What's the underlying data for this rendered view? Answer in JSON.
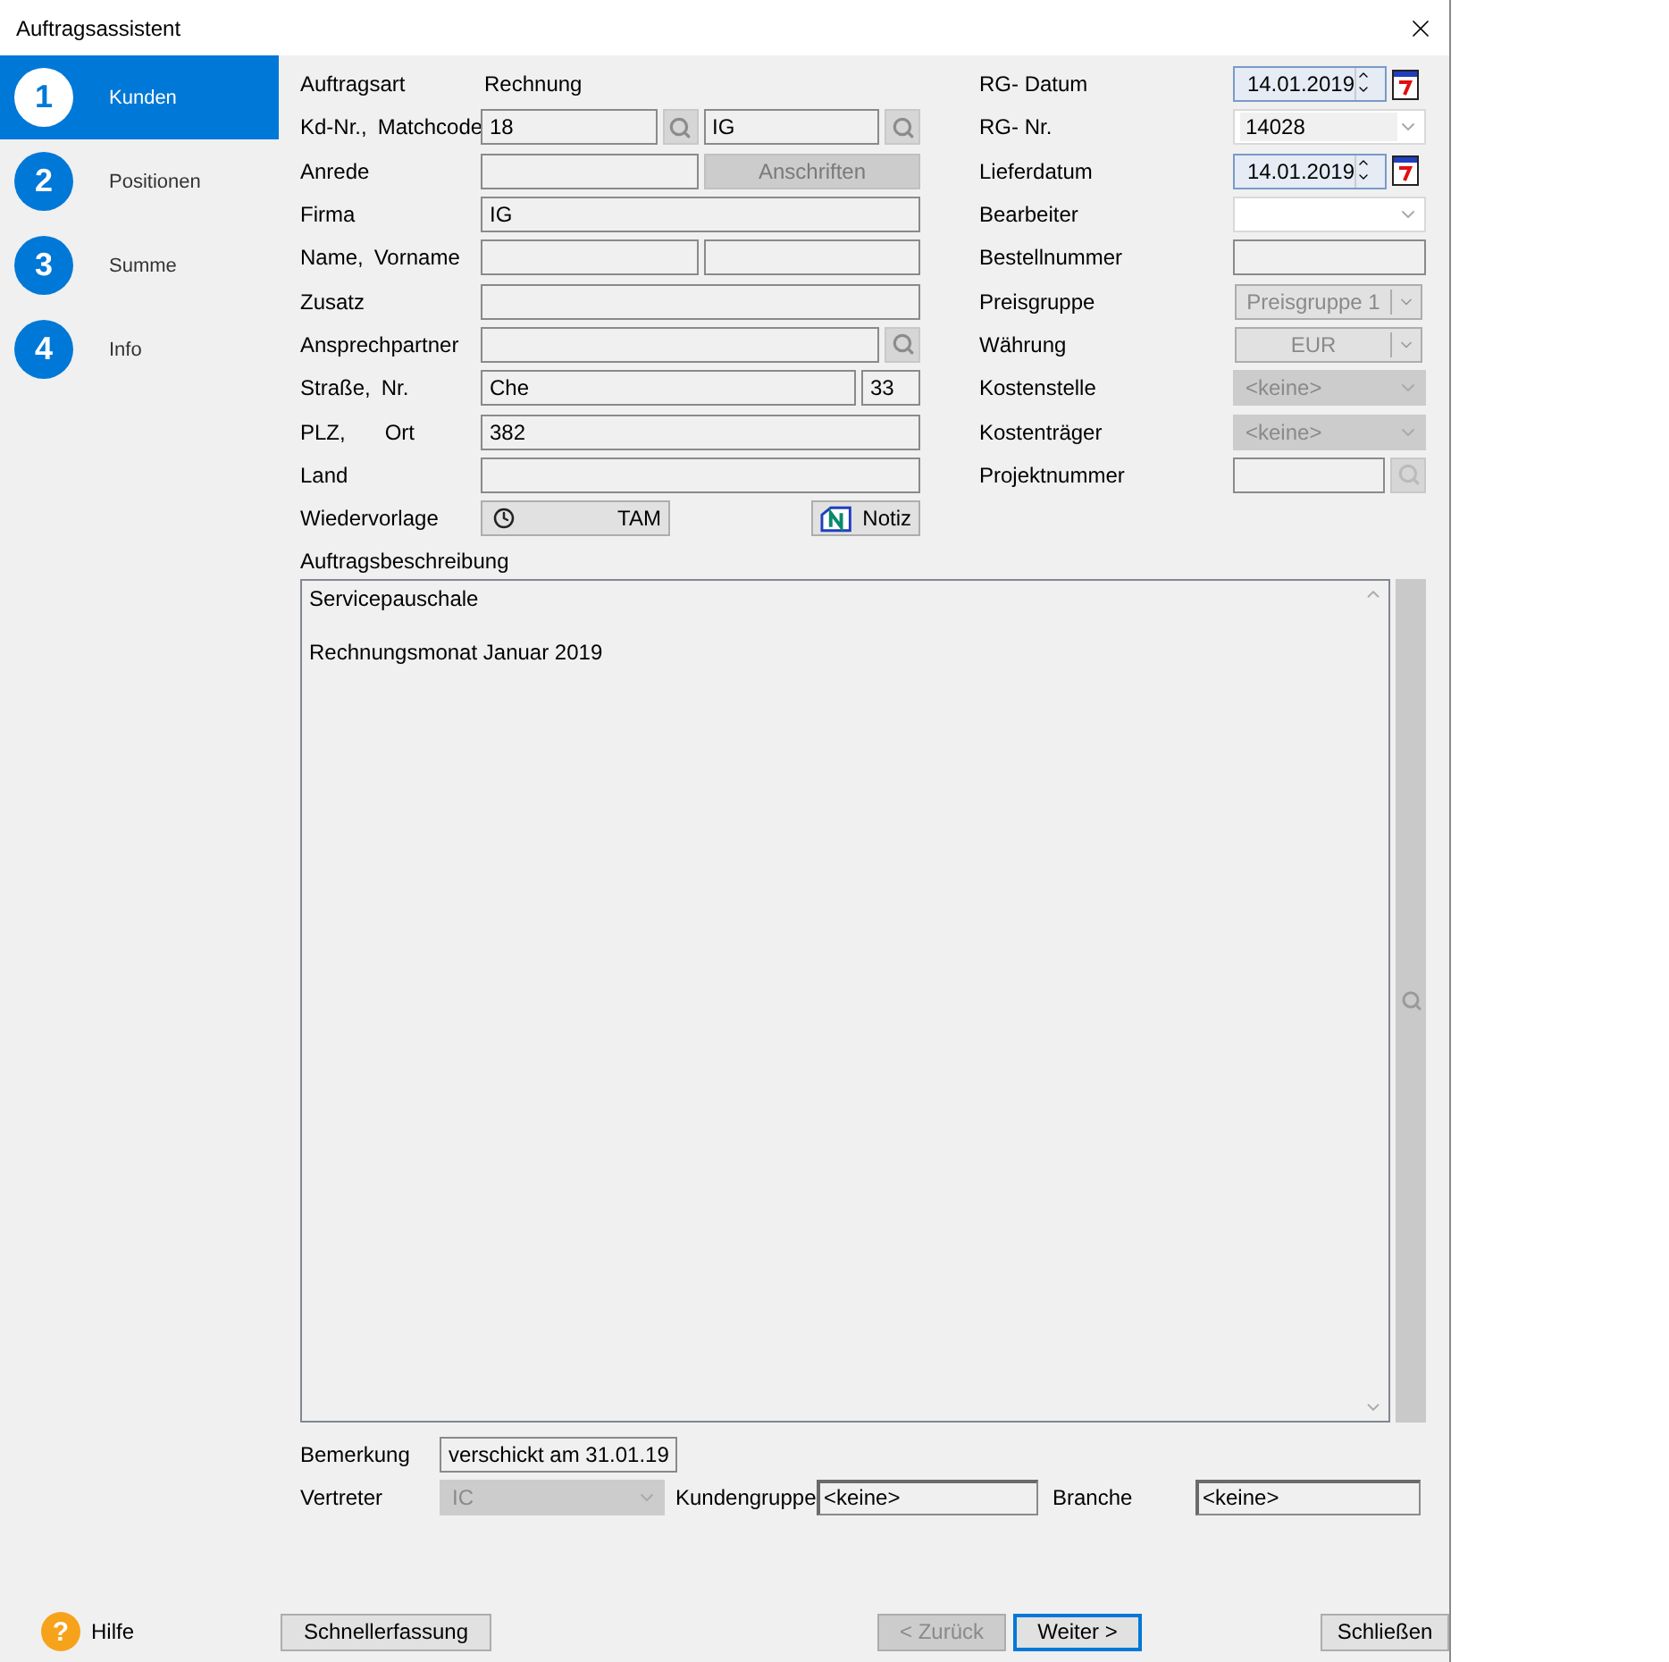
{
  "window": {
    "title": "Auftragsassistent"
  },
  "steps": [
    {
      "number": "1",
      "label": "Kunden",
      "selected": true
    },
    {
      "number": "2",
      "label": "Positionen",
      "selected": false
    },
    {
      "number": "3",
      "label": "Summe",
      "selected": false
    },
    {
      "number": "4",
      "label": "Info",
      "selected": false
    }
  ],
  "help": {
    "badge": "?",
    "label": "Hilfe"
  },
  "left_rows": [
    {
      "kind": "static",
      "labels": [
        "Auftragsart"
      ],
      "value": "Rechnung"
    },
    {
      "kind": "lookup_pair",
      "labels": [
        "Kd-Nr.,",
        "Matchcode"
      ],
      "values": [
        "18",
        "IG"
      ]
    },
    {
      "kind": "input_button",
      "labels": [
        "Anrede"
      ],
      "button": {
        "label": "Anschriften",
        "disabled": true
      }
    },
    {
      "kind": "input",
      "labels": [
        "Firma"
      ],
      "value": "IG"
    },
    {
      "kind": "pair",
      "labels": [
        "Name,",
        "Vorname"
      ]
    },
    {
      "kind": "input",
      "labels": [
        "Zusatz"
      ]
    },
    {
      "kind": "input_lookup",
      "labels": [
        "Ansprechpartner"
      ]
    },
    {
      "kind": "street",
      "labels": [
        "Straße,",
        "Nr."
      ],
      "values": [
        "Che",
        "33"
      ]
    },
    {
      "kind": "input",
      "labels": [
        "PLZ,",
        "Ort"
      ],
      "value": "382"
    },
    {
      "kind": "input",
      "labels": [
        "Land"
      ]
    },
    {
      "kind": "followup",
      "labels": [
        "Wiedervorlage"
      ],
      "value": "TAM",
      "button": {
        "label": "Notiz",
        "disabled": false
      }
    }
  ],
  "right_rows": [
    {
      "kind": "date",
      "label": "RG- Datum",
      "value": "14.01.2019"
    },
    {
      "kind": "combo",
      "label": "RG- Nr.",
      "value": "14028",
      "disabled": false
    },
    {
      "kind": "date",
      "label": "Lieferdatum",
      "value": "14.01.2019"
    },
    {
      "kind": "combo",
      "label": "Bearbeiter",
      "disabled": false
    },
    {
      "kind": "input",
      "label": "Bestellnummer"
    },
    {
      "kind": "split",
      "label": "Preisgruppe",
      "value": "Preisgruppe 1"
    },
    {
      "kind": "split",
      "label": "Währung",
      "value": "EUR"
    },
    {
      "kind": "combo",
      "label": "Kostenstelle",
      "value": "<keine>",
      "disabled": true
    },
    {
      "kind": "combo",
      "label": "Kostenträger",
      "value": "<keine>",
      "disabled": true
    },
    {
      "kind": "input_lookup",
      "label": "Projektnummer"
    }
  ],
  "description": {
    "label": "Auftragsbeschreibung",
    "paragraphs": [
      "Servicepauschale",
      "Rechnungsmonat Januar 2019"
    ]
  },
  "remark": {
    "label": "Bemerkung",
    "value": "verschickt am 31.01.19"
  },
  "agent": {
    "label": "Vertreter",
    "value": "IC",
    "disabled": true
  },
  "customer_group": {
    "label": "Kundengruppe",
    "value": "<keine>"
  },
  "industry": {
    "label": "Branche",
    "value": "<keine>"
  },
  "footer": [
    {
      "kind": "left",
      "label": "Schnellerfassung",
      "disabled": false,
      "default": false
    },
    {
      "kind": "nav",
      "label": "< Zurück",
      "disabled": true,
      "default": false
    },
    {
      "kind": "nav",
      "label": "Weiter >",
      "disabled": false,
      "default": true
    },
    {
      "kind": "right",
      "label": "Schließen",
      "disabled": false,
      "default": false
    }
  ]
}
